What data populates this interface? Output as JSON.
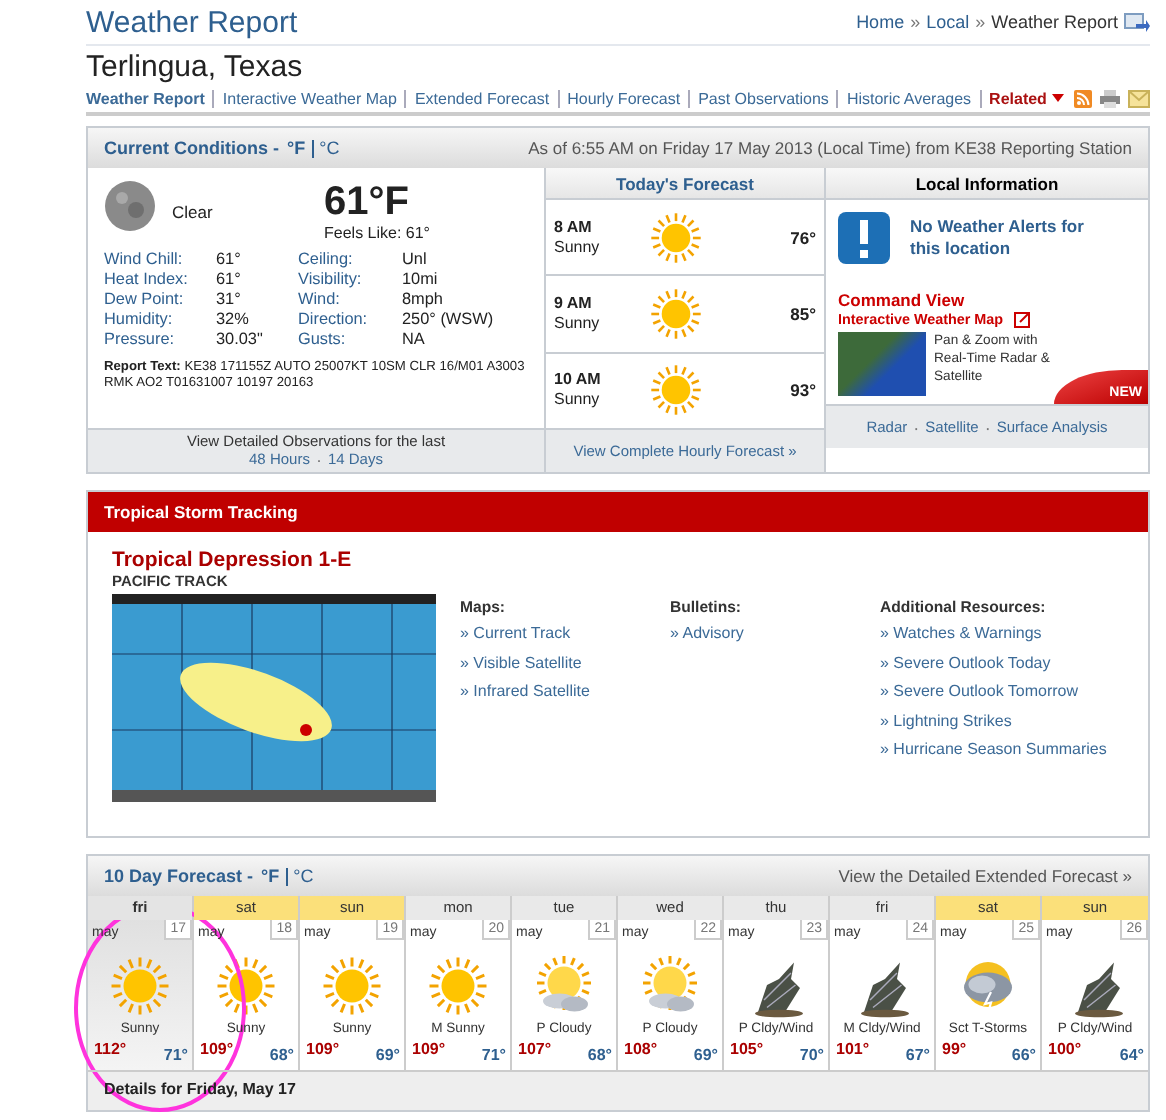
{
  "header": {
    "title": "Weather Report",
    "breadcrumb": {
      "separator": "»",
      "items": [
        "Home",
        "Local",
        "Weather Report"
      ]
    }
  },
  "location": "Terlingua, Texas",
  "nav": {
    "items": [
      {
        "label": "Weather Report",
        "selected": true
      },
      {
        "label": "Interactive Weather Map",
        "selected": false
      },
      {
        "label": "Extended Forecast",
        "selected": false
      },
      {
        "label": "Hourly Forecast",
        "selected": false
      },
      {
        "label": "Past Observations",
        "selected": false
      },
      {
        "label": "Historic Averages",
        "selected": false
      }
    ],
    "related": "Related"
  },
  "current": {
    "title": "Current Conditions -",
    "units": [
      {
        "label": "°F",
        "selected": true
      },
      {
        "label": "°C",
        "selected": false
      }
    ],
    "as_of": "As of 6:55 AM on Friday 17 May 2013 (Local Time) from KE38 Reporting Station",
    "condition": "Clear",
    "temperature": "61°F",
    "feels_like": "Feels Like: 61°",
    "stats_left": [
      {
        "label": "Wind Chill:",
        "value": "61°"
      },
      {
        "label": "Heat Index:",
        "value": "61°"
      },
      {
        "label": "Dew Point:",
        "value": "31°"
      },
      {
        "label": "Humidity:",
        "value": "32%"
      },
      {
        "label": "Pressure:",
        "value": "30.03\""
      }
    ],
    "stats_right": [
      {
        "label": "Ceiling:",
        "value": "Unl"
      },
      {
        "label": "Visibility:",
        "value": "10mi"
      },
      {
        "label": "Wind:",
        "value": "8mph"
      },
      {
        "label": "Direction:",
        "value": "250° (WSW)"
      },
      {
        "label": "Gusts:",
        "value": "NA"
      }
    ],
    "report_label": "Report Text:",
    "report_text": "KE38 171155Z AUTO 25007KT 10SM CLR 16/M01 A3003 RMK AO2 T01631007 10197 20163",
    "observations": {
      "text": "View Detailed Observations for the last",
      "links": [
        "48 Hours",
        "14 Days"
      ],
      "separator": "·"
    }
  },
  "today": {
    "title": "Today's Forecast",
    "hours": [
      {
        "time": "8 AM",
        "condition": "Sunny",
        "kind": "sunny",
        "temp": "76°"
      },
      {
        "time": "9 AM",
        "condition": "Sunny",
        "kind": "sunny",
        "temp": "85°"
      },
      {
        "time": "10 AM",
        "condition": "Sunny",
        "kind": "sunny",
        "temp": "93°"
      }
    ],
    "link": "View Complete Hourly Forecast »"
  },
  "local": {
    "title": "Local Information",
    "alert": "No Weather Alerts for this location",
    "command_title": "Command View",
    "command_subtitle": "Interactive Weather Map",
    "command_text": "Pan & Zoom with Real-Time Radar & Satellite",
    "badge": "NEW",
    "links": [
      "Radar",
      "Satellite",
      "Surface Analysis"
    ],
    "separator": "·"
  },
  "storm": {
    "title": "Tropical Storm Tracking",
    "name": "Tropical Depression 1-E",
    "track": "PACIFIC TRACK",
    "columns": [
      {
        "heading": "Maps:",
        "links": [
          "» Current Track",
          "» Visible Satellite",
          "» Infrared Satellite"
        ]
      },
      {
        "heading": "Bulletins:",
        "links": [
          "» Advisory"
        ]
      },
      {
        "heading": "Additional Resources:",
        "links": [
          "» Watches & Warnings",
          "» Severe Outlook Today",
          "» Severe Outlook Tomorrow",
          "» Lightning Strikes",
          "» Hurricane Season Summaries"
        ]
      }
    ]
  },
  "ten_day": {
    "title": "10 Day Forecast -",
    "units": [
      {
        "label": "°F",
        "selected": true
      },
      {
        "label": "°C",
        "selected": false
      }
    ],
    "link": "View the Detailed Extended Forecast »",
    "days": [
      {
        "day": "fri",
        "month": "may",
        "date": "17",
        "weekend": false,
        "selected": true,
        "kind": "sunny",
        "condition": "Sunny",
        "high": "112°",
        "low": "71°"
      },
      {
        "day": "sat",
        "month": "may",
        "date": "18",
        "weekend": true,
        "selected": false,
        "kind": "sunny",
        "condition": "Sunny",
        "high": "109°",
        "low": "68°"
      },
      {
        "day": "sun",
        "month": "may",
        "date": "19",
        "weekend": true,
        "selected": false,
        "kind": "sunny",
        "condition": "Sunny",
        "high": "109°",
        "low": "69°"
      },
      {
        "day": "mon",
        "month": "may",
        "date": "20",
        "weekend": false,
        "selected": false,
        "kind": "sunny",
        "condition": "M Sunny",
        "high": "109°",
        "low": "71°"
      },
      {
        "day": "tue",
        "month": "may",
        "date": "21",
        "weekend": false,
        "selected": false,
        "kind": "partly-cloudy",
        "condition": "P Cloudy",
        "high": "107°",
        "low": "68°"
      },
      {
        "day": "wed",
        "month": "may",
        "date": "22",
        "weekend": false,
        "selected": false,
        "kind": "partly-cloudy",
        "condition": "P Cloudy",
        "high": "108°",
        "low": "69°"
      },
      {
        "day": "thu",
        "month": "may",
        "date": "23",
        "weekend": false,
        "selected": false,
        "kind": "wind",
        "condition": "P Cldy/Wind",
        "high": "105°",
        "low": "70°"
      },
      {
        "day": "fri",
        "month": "may",
        "date": "24",
        "weekend": false,
        "selected": false,
        "kind": "wind",
        "condition": "M Cldy/Wind",
        "high": "101°",
        "low": "67°"
      },
      {
        "day": "sat",
        "month": "may",
        "date": "25",
        "weekend": true,
        "selected": false,
        "kind": "storms",
        "condition": "Sct T-Storms",
        "high": "99°",
        "low": "66°"
      },
      {
        "day": "sun",
        "month": "may",
        "date": "26",
        "weekend": true,
        "selected": false,
        "kind": "wind",
        "condition": "P Cldy/Wind",
        "high": "100°",
        "low": "64°"
      }
    ],
    "details": "Details for Friday, May 17"
  }
}
